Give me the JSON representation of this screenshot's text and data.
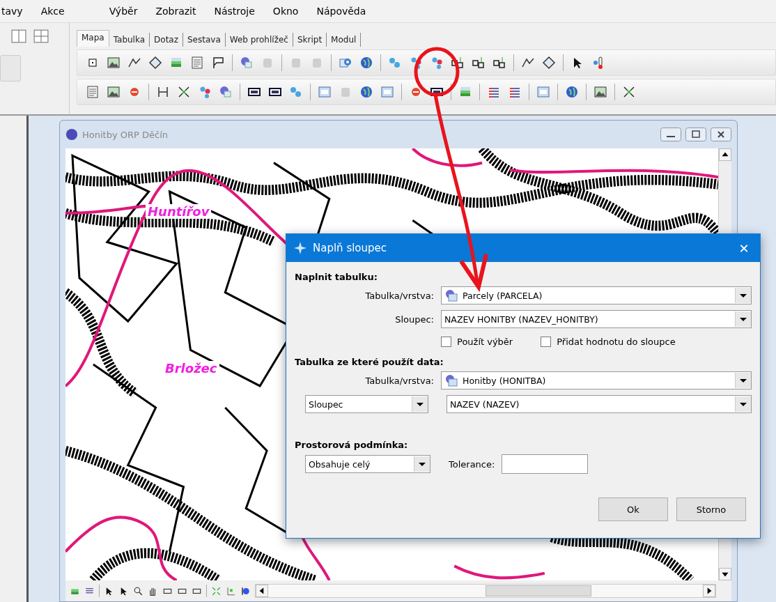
{
  "menu": [
    {
      "label": "tavy"
    },
    {
      "label": "Akce"
    },
    {
      "label": "Výběr"
    },
    {
      "label": "Zobrazit"
    },
    {
      "label": "Nástroje"
    },
    {
      "label": "Okno"
    },
    {
      "label": "Nápověda"
    }
  ],
  "tabs": [
    {
      "label": "Mapa",
      "selected": true
    },
    {
      "label": "Tabulka",
      "selected": false
    },
    {
      "label": "Dotaz",
      "selected": false
    },
    {
      "label": "Sestava",
      "selected": false
    },
    {
      "label": "Web prohlížeč",
      "selected": false
    },
    {
      "label": "Skript",
      "selected": false
    },
    {
      "label": "Modul",
      "selected": false
    }
  ],
  "map_window": {
    "title": "Honitby ORP Děčín",
    "labels": [
      "Huntířov",
      "Brložec"
    ]
  },
  "dialog": {
    "title": "Naplň sloupec",
    "close": "✕",
    "fill_table": {
      "heading": "Naplnit tabulku:",
      "layer_label": "Tabulka/vrstva:",
      "layer_value": "Parcely (PARCELA)",
      "column_label": "Sloupec:",
      "column_value": "NAZEV HONITBY (NAZEV_HONITBY)",
      "options": [
        {
          "label": "Použít výběr",
          "checked": false
        },
        {
          "label": "Přidat hodnotu do sloupce",
          "checked": false
        }
      ]
    },
    "source": {
      "heading": "Tabulka ze které použít data:",
      "layer_label": "Tabulka/vrstva:",
      "layer_value": "Honitby (HONITBA)",
      "column_mode": "Sloupec",
      "column_value": "NAZEV (NAZEV)"
    },
    "spatial": {
      "heading": "Prostorová podmínka:",
      "condition": "Obsahuje celý",
      "tolerance_label": "Tolerance:"
    },
    "buttons": [
      "Ok",
      "Storno"
    ]
  }
}
